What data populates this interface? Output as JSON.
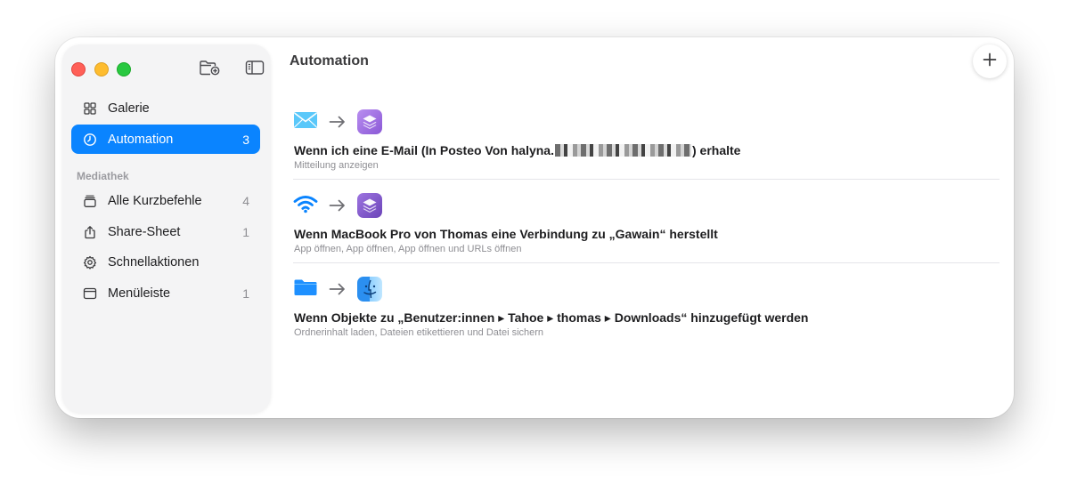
{
  "window": {
    "title": "Automation"
  },
  "toolbar": {
    "new_folder_icon": "folder-plus-icon",
    "sidebar_toggle_icon": "sidebar-icon",
    "add_icon": "plus-icon"
  },
  "sidebar": {
    "top_items": [
      {
        "label": "Galerie",
        "icon": "grid-icon",
        "count": ""
      },
      {
        "label": "Automation",
        "icon": "clock-icon",
        "count": "3",
        "selected": true
      }
    ],
    "section_label": "Mediathek",
    "library_items": [
      {
        "label": "Alle Kurzbefehle",
        "icon": "stack-icon",
        "count": "4"
      },
      {
        "label": "Share-Sheet",
        "icon": "share-icon",
        "count": "1"
      },
      {
        "label": "Schnellaktionen",
        "icon": "gear-icon",
        "count": ""
      },
      {
        "label": "Menüleiste",
        "icon": "menubar-icon",
        "count": "1"
      }
    ]
  },
  "automations": [
    {
      "trigger_icon": "mail-icon",
      "action_icon": "shortcuts-app-icon",
      "title_prefix": "Wenn ich eine E-Mail (In Posteo Von halyna.",
      "title_suffix": ") erhalte",
      "subtitle": "Mitteilung anzeigen"
    },
    {
      "trigger_icon": "wifi-icon",
      "action_icon": "shortcuts-app-icon",
      "title": "Wenn MacBook Pro von Thomas eine Verbindung zu „Gawain“ herstellt",
      "subtitle": "App öffnen, App öffnen, App öffnen und URLs öffnen"
    },
    {
      "trigger_icon": "folder-icon",
      "action_icon": "finder-app-icon",
      "title": "Wenn Objekte zu „Benutzer:innen ▸ Tahoe ▸ thomas ▸ Downloads“ hinzugefügt werden",
      "subtitle": "Ordnerinhalt laden, Dateien etikettieren und Datei sichern"
    }
  ],
  "colors": {
    "accent": "#0a84ff",
    "close": "#ff5f57",
    "minimize": "#febc2e",
    "zoom": "#28c840",
    "shortcuts_purple": "#9b6fe0"
  }
}
